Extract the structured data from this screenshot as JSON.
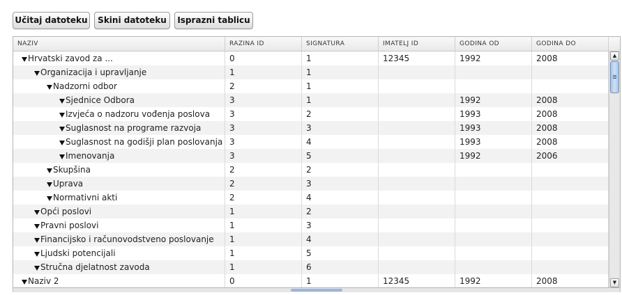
{
  "toolbar": {
    "load_label": "Učitaj datoteku",
    "download_label": "Skini datoteku",
    "clear_label": "Isprazni tablicu"
  },
  "columns": [
    "NAZIV",
    "RAZINA ID",
    "SIGNATURA",
    "IMATELJ ID",
    "GODINA OD",
    "GODINA DO"
  ],
  "rows": [
    {
      "level": 0,
      "naziv": "Hrvatski zavod za ...",
      "razina": "0",
      "signatura": "1",
      "imatelj": "12345",
      "od": "1992",
      "do": "2008"
    },
    {
      "level": 1,
      "naziv": "Organizacija i upravljanje",
      "razina": "1",
      "signatura": "1",
      "imatelj": "",
      "od": "",
      "do": ""
    },
    {
      "level": 2,
      "naziv": "Nadzorni odbor",
      "razina": "2",
      "signatura": "1",
      "imatelj": "",
      "od": "",
      "do": ""
    },
    {
      "level": 3,
      "naziv": "Sjednice Odbora",
      "razina": "3",
      "signatura": "1",
      "imatelj": "",
      "od": "1992",
      "do": "2008"
    },
    {
      "level": 3,
      "naziv": "Izvjeća o nadzoru vođenja poslova",
      "razina": "3",
      "signatura": "2",
      "imatelj": "",
      "od": "1993",
      "do": "2008"
    },
    {
      "level": 3,
      "naziv": "Suglasnost na programe razvoja",
      "razina": "3",
      "signatura": "3",
      "imatelj": "",
      "od": "1993",
      "do": "2008"
    },
    {
      "level": 3,
      "naziv": "Suglasnost na godišji plan poslovanja",
      "razina": "3",
      "signatura": "4",
      "imatelj": "",
      "od": "1993",
      "do": "2008"
    },
    {
      "level": 3,
      "naziv": "Imenovanja",
      "razina": "3",
      "signatura": "5",
      "imatelj": "",
      "od": "1992",
      "do": "2006"
    },
    {
      "level": 2,
      "naziv": "Skupšina",
      "razina": "2",
      "signatura": "2",
      "imatelj": "",
      "od": "",
      "do": ""
    },
    {
      "level": 2,
      "naziv": "Uprava",
      "razina": "2",
      "signatura": "3",
      "imatelj": "",
      "od": "",
      "do": ""
    },
    {
      "level": 2,
      "naziv": "Normativni akti",
      "razina": "2",
      "signatura": "4",
      "imatelj": "",
      "od": "",
      "do": ""
    },
    {
      "level": 1,
      "naziv": "Opći poslovi",
      "razina": "1",
      "signatura": "2",
      "imatelj": "",
      "od": "",
      "do": ""
    },
    {
      "level": 1,
      "naziv": "Pravni poslovi",
      "razina": "1",
      "signatura": "3",
      "imatelj": "",
      "od": "",
      "do": ""
    },
    {
      "level": 1,
      "naziv": "Financijsko i računovodstveno poslovanje",
      "razina": "1",
      "signatura": "4",
      "imatelj": "",
      "od": "",
      "do": ""
    },
    {
      "level": 1,
      "naziv": "Ljudski potencijali",
      "razina": "1",
      "signatura": "5",
      "imatelj": "",
      "od": "",
      "do": ""
    },
    {
      "level": 1,
      "naziv": "Stručna djelatnost zavoda",
      "razina": "1",
      "signatura": "6",
      "imatelj": "",
      "od": "",
      "do": ""
    },
    {
      "level": 0,
      "naziv": "Naziv 2",
      "razina": "0",
      "signatura": "1",
      "imatelj": "12345",
      "od": "1992",
      "do": "2008"
    }
  ],
  "scrollbar": {
    "up_icon": "▲",
    "down_icon": "▼"
  }
}
